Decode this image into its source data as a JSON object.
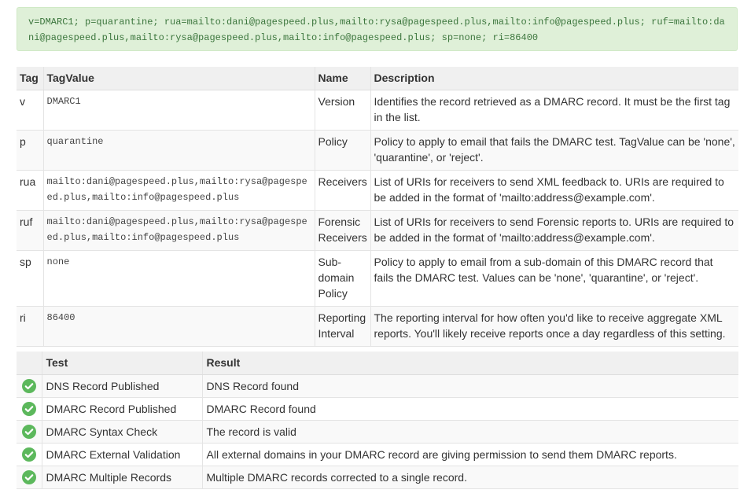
{
  "record": {
    "text": "v=DMARC1; p=quarantine; rua=mailto:dani@pagespeed.plus,mailto:rysa@pagespeed.plus,mailto:info@pagespeed.plus; ruf=mailto:dani@pagespeed.plus,mailto:rysa@pagespeed.plus,mailto:info@pagespeed.plus; sp=none; ri=86400"
  },
  "tags_table": {
    "headers": [
      "Tag",
      "TagValue",
      "Name",
      "Description"
    ],
    "rows": [
      {
        "tag": "v",
        "value": "DMARC1",
        "name": "Version",
        "description": "Identifies the record retrieved as a DMARC record. It must be the first tag in the list."
      },
      {
        "tag": "p",
        "value": "quarantine",
        "name": "Policy",
        "description": "Policy to apply to email that fails the DMARC test. TagValue can be 'none', 'quarantine', or 'reject'."
      },
      {
        "tag": "rua",
        "value": "mailto:dani@pagespeed.plus,mailto:rysa@pagespeed.plus,mailto:info@pagespeed.plus",
        "name": "Receivers",
        "description": "List of URIs for receivers to send XML feedback to. URIs are required to be added in the format of 'mailto:address@example.com'."
      },
      {
        "tag": "ruf",
        "value": "mailto:dani@pagespeed.plus,mailto:rysa@pagespeed.plus,mailto:info@pagespeed.plus",
        "name": "Forensic Receivers",
        "description": "List of URIs for receivers to send Forensic reports to. URIs are required to be added in the format of 'mailto:address@example.com'."
      },
      {
        "tag": "sp",
        "value": "none",
        "name": "Sub-domain Policy",
        "description": "Policy to apply to email from a sub-domain of this DMARC record that fails the DMARC test. Values can be 'none', 'quarantine', or 'reject'."
      },
      {
        "tag": "ri",
        "value": "86400",
        "name": "Reporting Interval",
        "description": "The reporting interval for how often you'd like to receive aggregate XML reports. You'll likely receive reports once a day regardless of this setting."
      }
    ]
  },
  "tests_table": {
    "headers": [
      "",
      "Test",
      "Result"
    ],
    "rows": [
      {
        "icon": "check-circle-icon",
        "test": "DNS Record Published",
        "result": "DNS Record found"
      },
      {
        "icon": "check-circle-icon",
        "test": "DMARC Record Published",
        "result": "DMARC Record found"
      },
      {
        "icon": "check-circle-icon",
        "test": "DMARC Syntax Check",
        "result": "The record is valid"
      },
      {
        "icon": "check-circle-icon",
        "test": "DMARC External Validation",
        "result": "All external domains in your DMARC record are giving permission to send them DMARC reports."
      },
      {
        "icon": "check-circle-icon",
        "test": "DMARC Multiple Records",
        "result": "Multiple DMARC records corrected to a single record."
      }
    ]
  },
  "colors": {
    "record_bg": "#dff0d8",
    "record_text": "#3c763d",
    "check_green": "#5cb85c",
    "header_bg": "#f0f0f0"
  }
}
